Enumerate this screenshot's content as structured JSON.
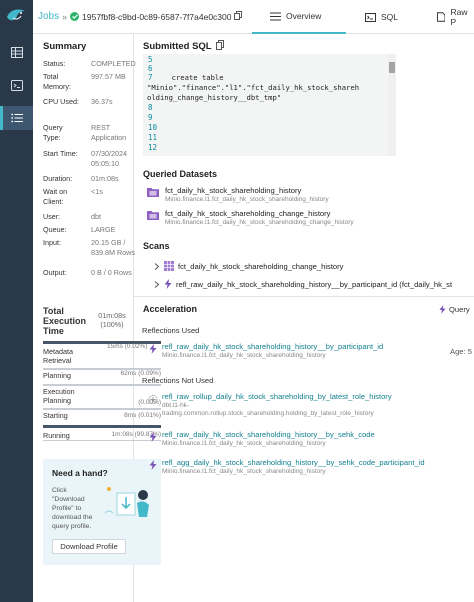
{
  "header": {
    "breadcrumb_root": "Jobs",
    "separator": "»",
    "job_id": "1957fbf8-c9bd-0c89-6587-7f7a4e0c300",
    "status_color": "#2cb46c",
    "tabs": [
      {
        "label": "Overview",
        "icon": "overview-icon",
        "active": true
      },
      {
        "label": "SQL",
        "icon": "sql-icon",
        "active": false
      },
      {
        "label": "Raw P",
        "icon": "raw-profile-icon",
        "active": false
      }
    ]
  },
  "rail": {
    "items": [
      "datasets-icon",
      "sql-runner-icon",
      "jobs-icon"
    ],
    "active": "jobs-icon",
    "accent": "#43b8c9"
  },
  "summary": {
    "title": "Summary",
    "rows": [
      {
        "k": "Status:",
        "v": "COMPLETED"
      },
      {
        "k": "Total Memory:",
        "v": "997.57 MB"
      },
      {
        "k": "CPU Used:",
        "v": "36.37s"
      },
      {
        "k": "Query Type:",
        "v": "REST Application"
      },
      {
        "k": "Start Time:",
        "v": "07/30/2024 05:05:10"
      },
      {
        "k": "Duration:",
        "v": "01m:08s"
      },
      {
        "k": "Wait on Client:",
        "v": "<1s"
      },
      {
        "k": "User:",
        "v": "dbt"
      },
      {
        "k": "Queue:",
        "v": "LARGE"
      },
      {
        "k": "Input:",
        "v": "20.15 GB / 839.8M Rows"
      },
      {
        "k": "Output:",
        "v": "0 B / 0 Rows"
      }
    ]
  },
  "execution": {
    "title": "Total Execution Time",
    "total": "01m:08s (100%)",
    "phases": [
      {
        "name": "Metadata Retrieval",
        "value": "15ms (0.02%)",
        "fraction": 0.0002
      },
      {
        "name": "Planning",
        "value": "62ms (0.09%)",
        "fraction": 0.0009
      },
      {
        "name": "Execution Planning",
        "value": "(0.00%)",
        "fraction": 0.0
      },
      {
        "name": "Starting",
        "value": "8ms (0.01%)",
        "fraction": 0.0001
      },
      {
        "name": "Running",
        "value": "1m:08s (99.87%)",
        "fraction": 0.9987
      }
    ]
  },
  "help": {
    "title": "Need a hand?",
    "text": "Click \"Download Profile\" to download the query profile.",
    "button": "Download Profile"
  },
  "sql": {
    "title": "Submitted SQL",
    "lines": [
      {
        "n": "5",
        "text": ""
      },
      {
        "n": "6",
        "text": ""
      },
      {
        "n": "7",
        "text": "  create table"
      },
      {
        "n": "",
        "text": "\"Minio\".\"finance\".\"l1\".\"fct_daily_hk_stock_shareh"
      },
      {
        "n": "",
        "text": "olding_change_history__dbt_tmp\""
      },
      {
        "n": "8",
        "text": ""
      },
      {
        "n": "9",
        "text": ""
      },
      {
        "n": "10",
        "text": ""
      },
      {
        "n": "11",
        "text": ""
      },
      {
        "n": "12",
        "text": ""
      }
    ]
  },
  "datasets": {
    "title": "Queried Datasets",
    "items": [
      {
        "name": "fct_daily_hk_stock_shareholding_history",
        "path": "Minio.finance.l1.fct_daily_hk_stock_shareholding_history"
      },
      {
        "name": "fct_daily_hk_stock_shareholding_change_history",
        "path": "Minio.finance.l1.fct_daily_hk_stock_shareholding_change_history"
      }
    ]
  },
  "scans": {
    "title": "Scans",
    "items": [
      {
        "name": "fct_daily_hk_stock_shareholding_change_history",
        "icon": "table-icon"
      },
      {
        "name": "refl_raw_daily_hk_stock_shareholding_history__by_participant_id (fct_daily_hk_st",
        "icon": "reflection-icon"
      }
    ]
  },
  "acceleration": {
    "title": "Acceleration",
    "query_label": "Query",
    "used_title": "Reflections Used",
    "used": [
      {
        "name": "refl_raw_daily_hk_stock_shareholding_history__by_participant_id",
        "path": "Minio.finance.l1.fct_daily_hk_stock_shareholding_history",
        "age": "Age: 5"
      }
    ],
    "not_used_title": "Reflections Not Used",
    "not_used": [
      {
        "name": "refl_raw_rollup_daily_hk_stock_shareholding_by_latest_role_history",
        "path": "dbt.l1-hk-trading.common.rollup.stock_shareholding.holding_by_latest_role_history",
        "path_line1": "dbt.l1-hk-",
        "path_line2": "trading.common.rollup.stock_shareholding.holding_by_latest_role_history"
      },
      {
        "name": "refl_raw_daily_hk_stock_shareholding_history__by_sehk_code",
        "path": "Minio.finance.l1.fct_daily_hk_stock_shareholding_history"
      },
      {
        "name": "refl_agg_daily_hk_stock_shareholding_history__by_sehk_code_participant_id",
        "path": "Minio.finance.l1.fct_daily_hk_stock_shareholding_history"
      }
    ]
  }
}
